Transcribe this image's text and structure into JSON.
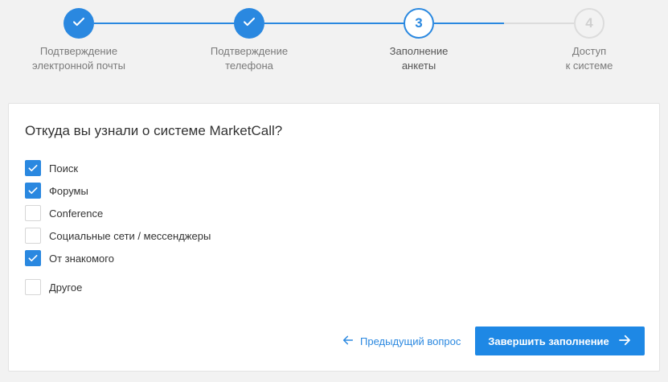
{
  "stepper": {
    "steps": [
      {
        "label": "Подтверждение\nэлектронной почты",
        "status": "done",
        "icon": "check-icon"
      },
      {
        "label": "Подтверждение\nтелефона",
        "status": "done",
        "icon": "check-icon"
      },
      {
        "label": "Заполнение\nанкеты",
        "status": "current",
        "number": "3"
      },
      {
        "label": "Доступ\nк системе",
        "status": "pending",
        "number": "4"
      }
    ]
  },
  "form": {
    "question": "Откуда вы узнали о системе MarketCall?",
    "options": [
      {
        "label": "Поиск",
        "checked": true
      },
      {
        "label": "Форумы",
        "checked": true
      },
      {
        "label": "Conference",
        "checked": false
      },
      {
        "label": "Социальные сети / мессенджеры",
        "checked": false
      },
      {
        "label": "От знакомого",
        "checked": true
      },
      {
        "label": "Другое",
        "checked": false
      }
    ]
  },
  "actions": {
    "prev_label": "Предыдущий вопрос",
    "prev_icon": "arrow-left-icon",
    "finish_label": "Завершить заполнение",
    "finish_icon": "arrow-right-icon"
  },
  "colors": {
    "accent": "#2a88e0",
    "button": "#1e88e5",
    "inactive": "#dcdcdc",
    "background": "#f2f2f2"
  }
}
